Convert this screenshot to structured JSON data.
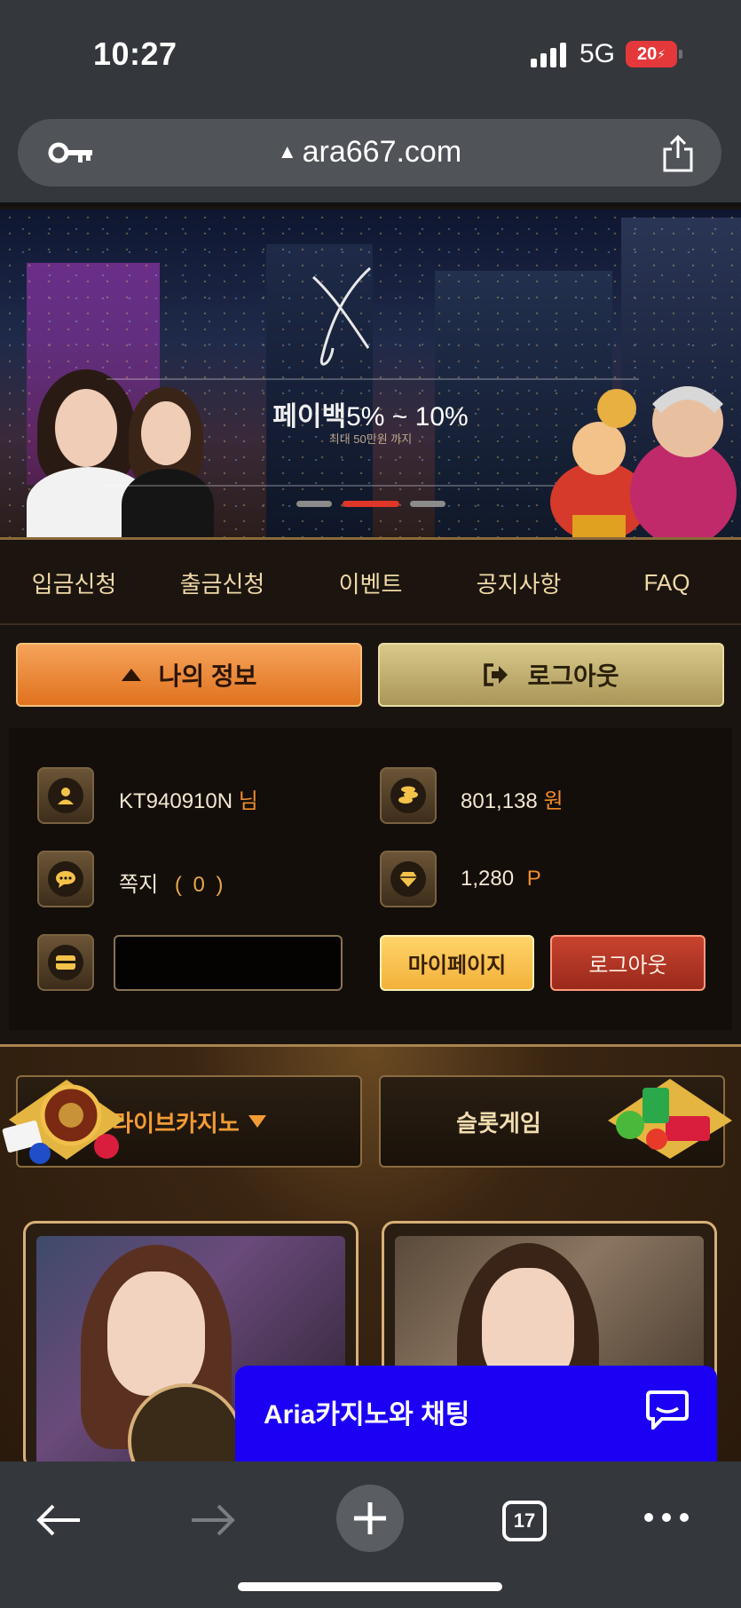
{
  "status_bar": {
    "time": "10:27",
    "network": "5G",
    "battery": "20"
  },
  "browser": {
    "url": "ara667.com",
    "tab_count": "17"
  },
  "banner": {
    "promo_bold": "페이백",
    "promo_rest": "5% ~ 10%",
    "promo_sub": "최대 50만원 까지",
    "slide_count": 3,
    "active_slide": 2
  },
  "nav": {
    "items": [
      {
        "label": "입금신청"
      },
      {
        "label": "출금신청"
      },
      {
        "label": "이벤트"
      },
      {
        "label": "공지사항"
      },
      {
        "label": "FAQ"
      }
    ]
  },
  "actions": {
    "my_info_label": "나의 정보",
    "logout_label": "로그아웃"
  },
  "account": {
    "username": "KT940910N",
    "honorific": "님",
    "balance": "801,138",
    "currency": "원",
    "messages_label": "쪽지",
    "messages_count": "( 0 )",
    "points": "1,280",
    "points_unit": "P",
    "mypage_label": "마이페이지",
    "logout_label": "로그아웃"
  },
  "games": {
    "live_casino_label": "라이브카지노",
    "slot_label": "슬롯게임"
  },
  "chat": {
    "label": "Aria카지노와 채팅"
  },
  "colors": {
    "accent_orange": "#f08c2a",
    "nav_text": "#f0d9a8",
    "chat_blue": "#1b00f4"
  }
}
